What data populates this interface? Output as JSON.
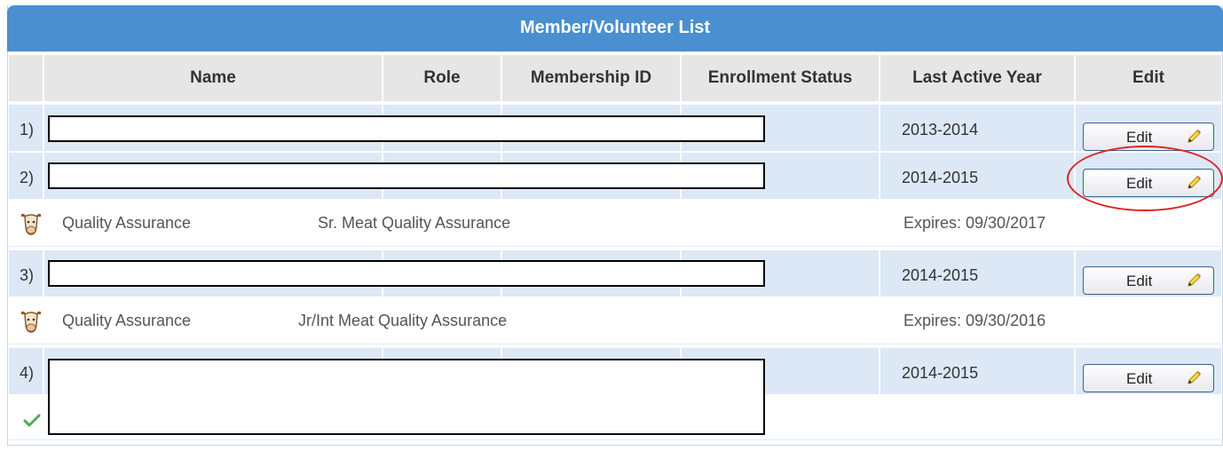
{
  "title": "Member/Volunteer List",
  "columns": [
    "Name",
    "Role",
    "Membership ID",
    "Enrollment Status",
    "Last Active Year",
    "Edit"
  ],
  "rows": [
    {
      "num": "1)",
      "year": "2013-2014",
      "edit_label": "Edit"
    },
    {
      "num": "2)",
      "year": "2014-2015",
      "edit_label": "Edit"
    },
    {
      "num": "3)",
      "year": "2014-2015",
      "edit_label": "Edit"
    },
    {
      "num": "4)",
      "year": "2014-2015",
      "edit_label": "Edit"
    }
  ],
  "qa": [
    {
      "type": "Quality Assurance",
      "course": "Sr. Meat Quality Assurance",
      "expires": "Expires: 09/30/2017"
    },
    {
      "type": "Quality Assurance",
      "course": "Jr/Int Meat Quality Assurance",
      "expires": "Expires: 09/30/2016"
    }
  ],
  "icons": {
    "qa_icon": "cow-head-icon",
    "edit_icon": "pencil-icon",
    "status_icon": "checkmark-icon"
  },
  "colors": {
    "title_bar": "#4a8fd0",
    "row_bg": "#dce8f5",
    "header_bg": "#e6e6e6",
    "annotation": "#dd2222"
  }
}
